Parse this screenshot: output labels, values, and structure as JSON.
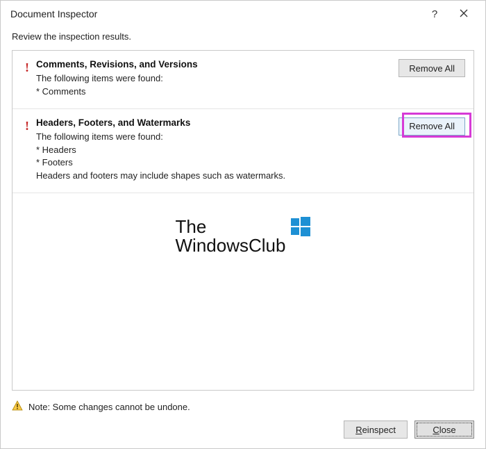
{
  "titlebar": {
    "title": "Document Inspector",
    "help_label": "?",
    "close_label": "✕"
  },
  "instructions": "Review the inspection results.",
  "results": [
    {
      "title": "Comments, Revisions, and Versions",
      "intro": "The following items were found:",
      "items": [
        "* Comments"
      ],
      "note": "",
      "remove_label": "Remove All",
      "highlighted": false
    },
    {
      "title": "Headers, Footers, and Watermarks",
      "intro": "The following items were found:",
      "items": [
        "* Headers",
        "* Footers"
      ],
      "note": "Headers and footers may include shapes such as watermarks.",
      "remove_label": "Remove All",
      "highlighted": true
    }
  ],
  "watermark": {
    "line1": "The",
    "line2": "WindowsClub"
  },
  "footer": {
    "warning": "Note: Some changes cannot be undone.",
    "reinspect_label": "Reinspect",
    "reinspect_mn": "R",
    "close_label": "Close",
    "close_mn": "C"
  }
}
